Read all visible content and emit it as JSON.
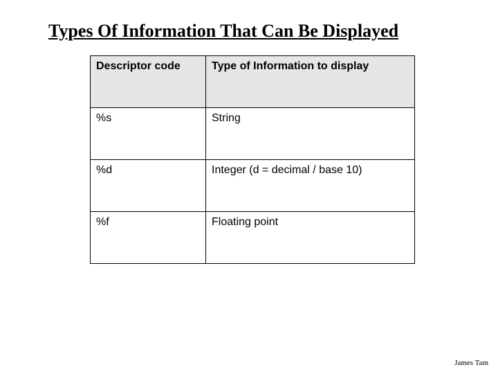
{
  "title": "Types Of Information That Can Be Displayed",
  "table": {
    "headers": {
      "code": "Descriptor code",
      "type": "Type of Information to display"
    },
    "rows": [
      {
        "code": "%s",
        "type": "String"
      },
      {
        "code": "%d",
        "type": "Integer (d = decimal / base 10)"
      },
      {
        "code": "%f",
        "type": "Floating point"
      }
    ]
  },
  "footer": "James Tam"
}
